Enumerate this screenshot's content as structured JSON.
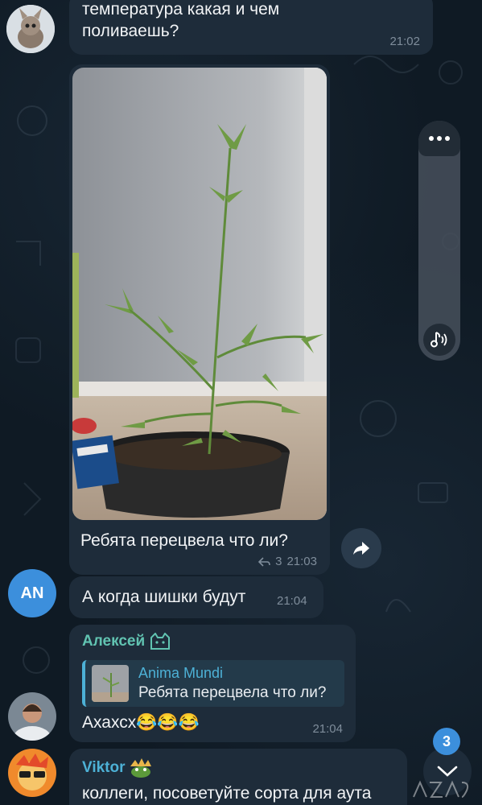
{
  "messages": {
    "m1": {
      "text": "температура какая и чем поливаешь?",
      "time": "21:02"
    },
    "m2": {
      "caption": "Ребята перецвела что ли?",
      "reply_count": "3",
      "time": "21:03"
    },
    "m3": {
      "avatar_initials": "AN",
      "text": "А когда шишки будут",
      "time": "21:04"
    },
    "m4": {
      "sender": "Алексей",
      "reply_author": "Anima Mundi",
      "reply_text": "Ребята перецвела что ли?",
      "text": "Ахахсх😂😂😂",
      "time": "21:04"
    },
    "m5": {
      "sender": "Viktor",
      "text": "коллеги, посоветуйте сорта для аута"
    }
  },
  "unread_badge": "3",
  "colors": {
    "background": "#0e1621",
    "bubble": "#1e2c3a",
    "accent_blue": "#4db1d6",
    "accent_green": "#61c3b1"
  },
  "icons": [
    "share-icon",
    "more-dots-icon",
    "audio-note-icon",
    "chevron-down-icon",
    "reply-arrow-icon"
  ]
}
